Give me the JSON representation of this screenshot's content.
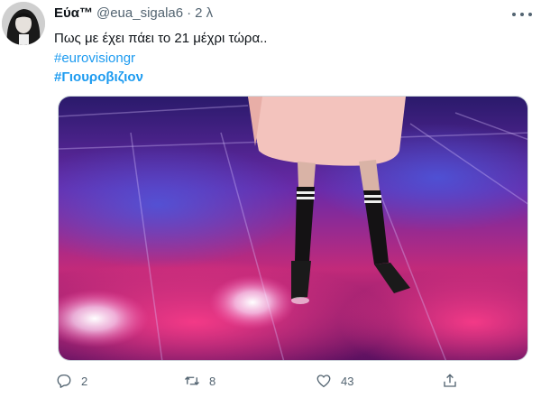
{
  "user": {
    "display_name": "Εύα™",
    "handle": "@eua_sigala6",
    "separator": "·",
    "time": "2 λ"
  },
  "tweet": {
    "text": "Πως με έχει πάει το 21 μέχρι τώρα..",
    "hashtags": [
      "#eurovisiongr",
      "#Γιουροβιζιον"
    ]
  },
  "actions": {
    "replies": "2",
    "retweets": "8",
    "likes": "43"
  },
  "icons": {
    "more": "more-icon",
    "reply": "reply-icon",
    "retweet": "retweet-icon",
    "like": "heart-icon",
    "share": "share-icon"
  },
  "colors": {
    "accent": "#1d9bf0",
    "secondary_text": "#536471",
    "primary_text": "#0f1419"
  }
}
